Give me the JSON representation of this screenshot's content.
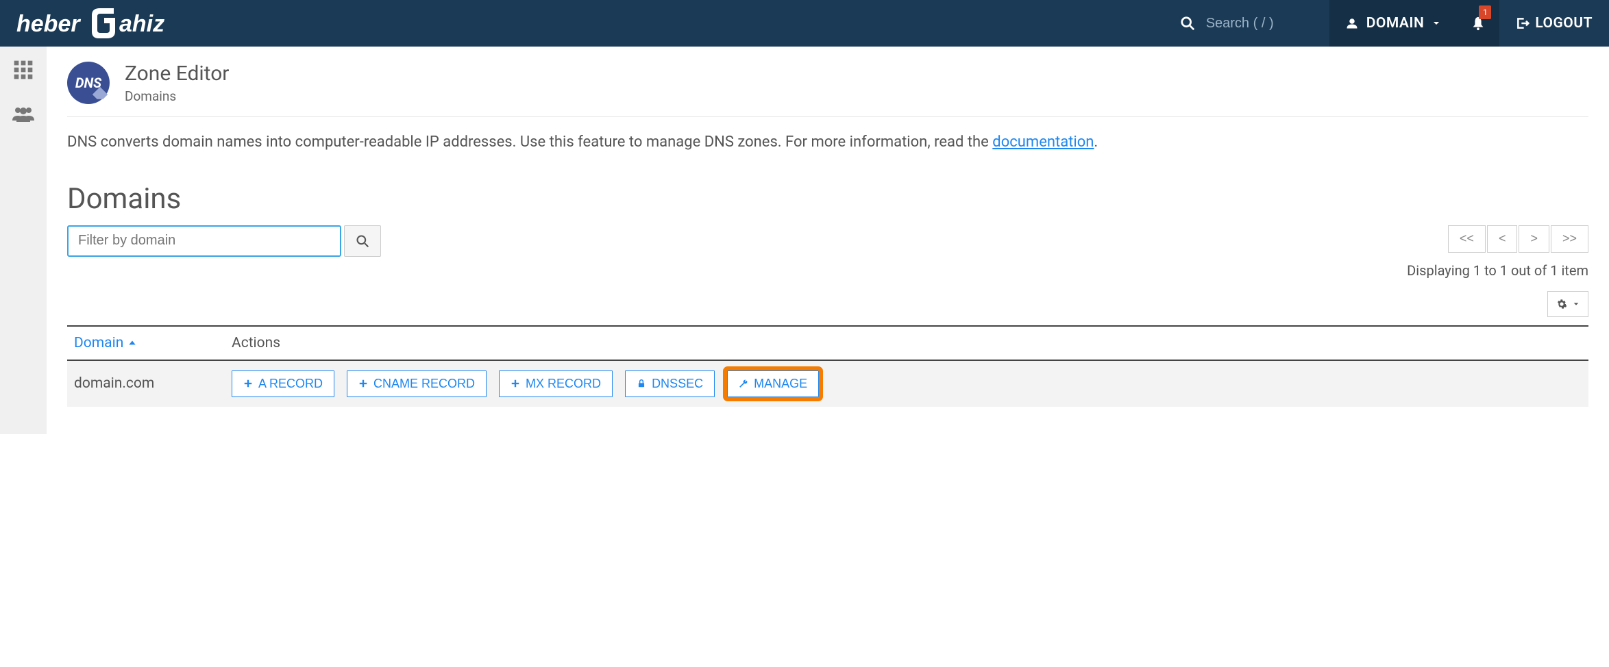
{
  "brand": "heberjahiz",
  "header": {
    "search_placeholder": "Search ( / )",
    "user_label": "DOMAIN",
    "logout_label": "LOGOUT",
    "notification_count": "1"
  },
  "page": {
    "title": "Zone Editor",
    "subtitle": "Domains",
    "badge": "DNS",
    "description_pre": "DNS converts domain names into computer-readable IP addresses. Use this feature to manage DNS zones. For more information, read the ",
    "description_link": "documentation",
    "description_post": "."
  },
  "domains_section_title": "Domains",
  "filter": {
    "placeholder": "Filter by domain"
  },
  "pager": {
    "first": "<<",
    "prev": "<",
    "next": ">",
    "last": ">>",
    "status": "Displaying 1 to 1 out of 1 item"
  },
  "table": {
    "col_domain": "Domain",
    "col_actions": "Actions",
    "rows": [
      {
        "domain": "domain.com",
        "a_record": "A RECORD",
        "cname_record": "CNAME RECORD",
        "mx_record": "MX RECORD",
        "dnssec": "DNSSEC",
        "manage": "MANAGE"
      }
    ]
  }
}
